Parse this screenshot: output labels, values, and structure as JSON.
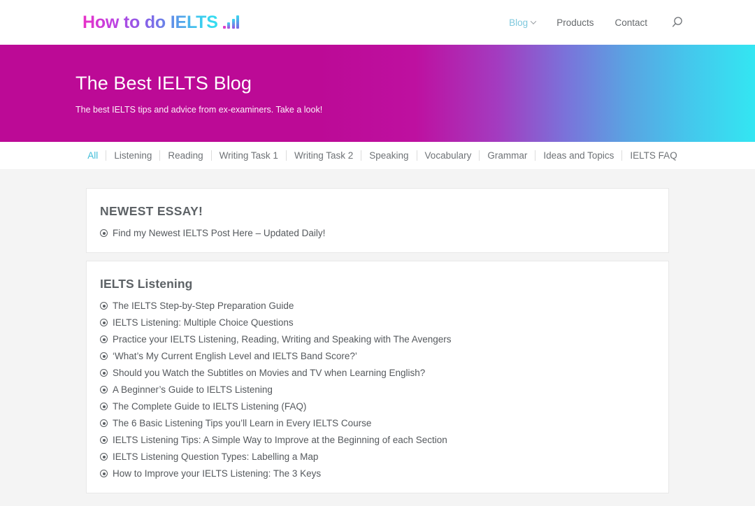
{
  "header": {
    "logo": {
      "text_part1": "How to do ",
      "text_part2": "IELTS",
      "icon": "bar-chart-icon"
    },
    "nav": [
      {
        "label": "Blog",
        "active": true,
        "has_dropdown": true
      },
      {
        "label": "Products",
        "active": false,
        "has_dropdown": false
      },
      {
        "label": "Contact",
        "active": false,
        "has_dropdown": false
      }
    ],
    "search_icon": "search-icon"
  },
  "hero": {
    "title": "The Best IELTS Blog",
    "subtitle": "The best IELTS tips and advice from ex-examiners. Take a look!",
    "gradient_start": "#bc0a96",
    "gradient_end": "#33e6f2"
  },
  "filters": {
    "active": "All",
    "items": [
      "All",
      "Listening",
      "Reading",
      "Writing Task 1",
      "Writing Task 2",
      "Speaking",
      "Vocabulary",
      "Grammar",
      "Ideas and Topics",
      "IELTS FAQ"
    ],
    "active_color": "#3fbcd8"
  },
  "cards": [
    {
      "title": "NEWEST ESSAY!",
      "posts": [
        "Find my Newest IELTS Post Here – Updated Daily!"
      ]
    },
    {
      "title": "IELTS Listening",
      "posts": [
        "The IELTS Step-by-Step Preparation Guide",
        "IELTS Listening: Multiple Choice Questions",
        "Practice your IELTS Listening, Reading, Writing and Speaking with The Avengers",
        "‘What’s My Current English Level and IELTS Band Score?’",
        "Should you Watch the Subtitles on Movies and TV when Learning English?",
        "A Beginner’s Guide to IELTS Listening",
        "The Complete Guide to IELTS Listening (FAQ)",
        "The 6 Basic Listening Tips you’ll Learn in Every IELTS Course",
        "IELTS Listening Tips: A Simple Way to Improve at the Beginning of each Section",
        "IELTS Listening Question Types: Labelling a Map",
        "How to Improve your IELTS Listening: The 3 Keys"
      ]
    }
  ]
}
